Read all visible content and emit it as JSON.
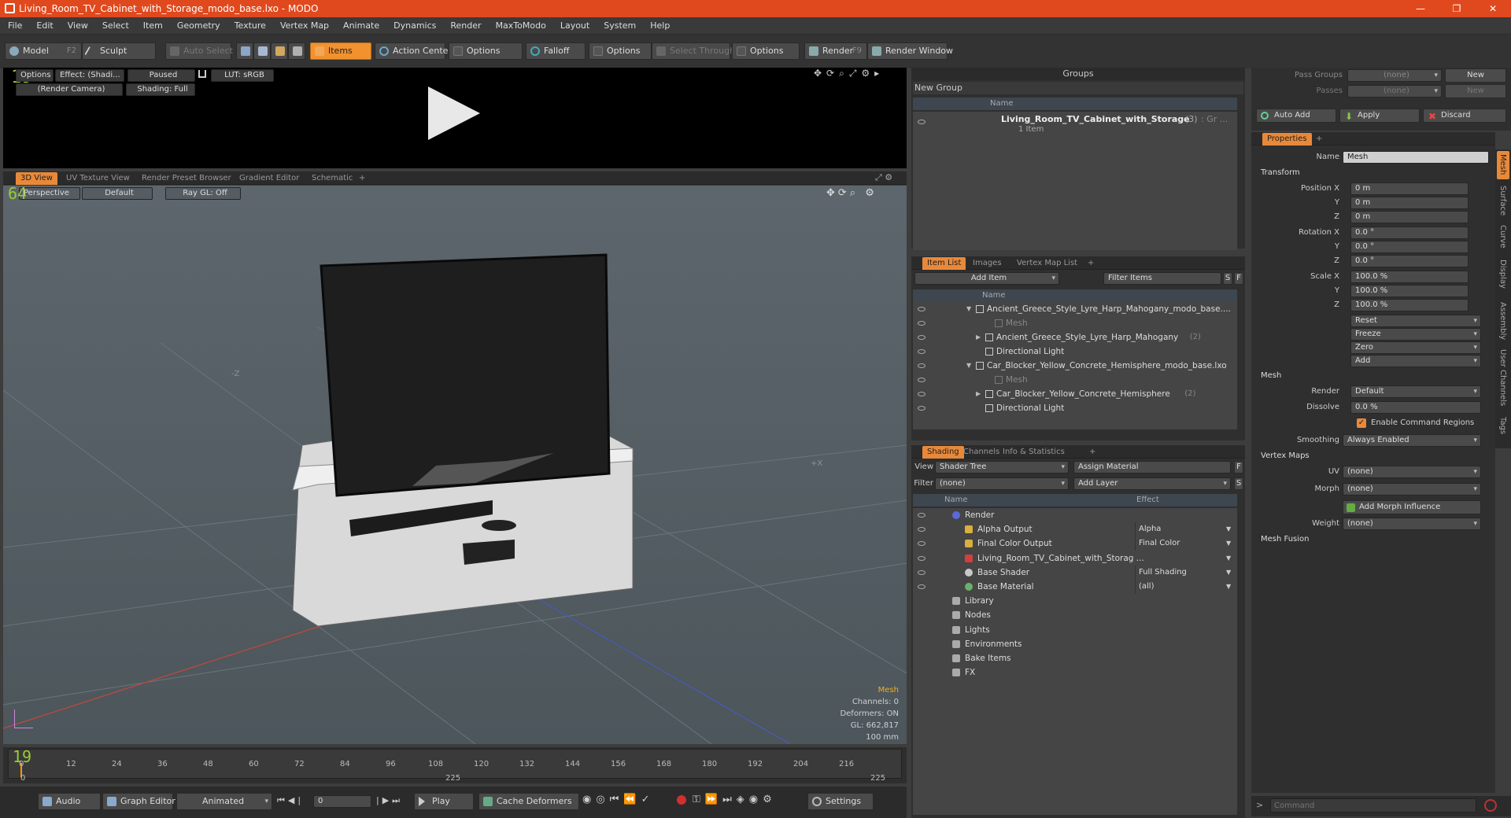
{
  "window": {
    "title": "Living_Room_TV_Cabinet_with_Storage_modo_base.lxo - MODO",
    "minimize": "—",
    "maximize": "❐",
    "close": "✕"
  },
  "menu": [
    "File",
    "Edit",
    "View",
    "Select",
    "Item",
    "Geometry",
    "Texture",
    "Vertex Map",
    "Animate",
    "Dynamics",
    "Render",
    "MaxToModo",
    "Layout",
    "System",
    "Help"
  ],
  "toolbar": {
    "model": "Model",
    "model_key": "F2",
    "sculpt": "Sculpt",
    "auto_select": "Auto Select",
    "items": "Items",
    "action_center": "Action Center",
    "options1": "Options",
    "falloff": "Falloff",
    "options2": "Options",
    "select_through": "Select Through",
    "options3": "Options",
    "render": "Render",
    "render_key": "F9",
    "render_window": "Render Window",
    "accent": "#f2922f"
  },
  "preview": {
    "options": "Options",
    "effect": "Effect: (Shadi...",
    "paused": "Paused",
    "lut": "LUT: sRGB",
    "camera": "(Render Camera)",
    "shading": "Shading: Full",
    "fps": "19"
  },
  "viewport_tabs": [
    "3D View",
    "UV Texture View",
    "Render Preset Browser",
    "Gradient Editor",
    "Schematic",
    "+"
  ],
  "viewport": {
    "perspective": "Perspective",
    "default": "Default",
    "raygl": "Ray GL: Off",
    "fps": "64",
    "info": {
      "selection": "Mesh",
      "channels": "Channels: 0",
      "deformers": "Deformers: ON",
      "gl": "GL: 662,817",
      "scale": "100 mm"
    },
    "axis_z": "-Z",
    "axis_x": "+X"
  },
  "timeline": {
    "ticks": [
      "0",
      "12",
      "24",
      "36",
      "48",
      "60",
      "72",
      "84",
      "96",
      "108",
      "120",
      "132",
      "144",
      "156",
      "168",
      "180",
      "192",
      "204",
      "216"
    ],
    "end": "225",
    "end2": "225",
    "start": "0",
    "frame_marker": "0"
  },
  "bottombar": {
    "audio": "Audio",
    "graph_editor": "Graph Editor",
    "animated": "Animated",
    "frame": "0",
    "play": "Play",
    "cache": "Cache Deformers",
    "settings": "Settings"
  },
  "groups": {
    "title": "Groups",
    "new_group": "New Group",
    "col_name": "Name",
    "item": "Living_Room_TV_Cabinet_with_Storage",
    "item_count": "(3)",
    "item_suffix": ": Gr ...",
    "item_sub": "1 Item"
  },
  "itemlist": {
    "tabs": [
      "Item List",
      "Images",
      "Vertex Map List",
      "+"
    ],
    "add_item": "Add Item",
    "filter": "Filter Items",
    "col_name": "Name",
    "s": "S",
    "f": "F",
    "rows": [
      {
        "label": "Ancient_Greece_Style_Lyre_Harp_Mahogany_modo_base....",
        "indent": 0,
        "arrow": "▼",
        "dim": false,
        "count": ""
      },
      {
        "label": "Mesh",
        "indent": 2,
        "arrow": "",
        "dim": true,
        "count": ""
      },
      {
        "label": "Ancient_Greece_Style_Lyre_Harp_Mahogany",
        "indent": 1,
        "arrow": "▶",
        "dim": false,
        "count": "(2)"
      },
      {
        "label": "Directional Light",
        "indent": 1,
        "arrow": "",
        "dim": false,
        "count": ""
      },
      {
        "label": "Car_Blocker_Yellow_Concrete_Hemisphere_modo_base.lxo",
        "indent": 0,
        "arrow": "▼",
        "dim": false,
        "count": ""
      },
      {
        "label": "Mesh",
        "indent": 2,
        "arrow": "",
        "dim": true,
        "count": ""
      },
      {
        "label": "Car_Blocker_Yellow_Concrete_Hemisphere",
        "indent": 1,
        "arrow": "▶",
        "dim": false,
        "count": "(2)"
      },
      {
        "label": "Directional Light",
        "indent": 1,
        "arrow": "",
        "dim": false,
        "count": ""
      }
    ]
  },
  "shading": {
    "tabs": [
      "Shading",
      "Channels",
      "Info & Statistics",
      "+"
    ],
    "view_label": "View",
    "view_value": "Shader Tree",
    "assign": "Assign Material",
    "filter_label": "Filter",
    "filter_value": "(none)",
    "add_layer": "Add Layer",
    "col_name": "Name",
    "col_effect": "Effect",
    "f": "F",
    "s": "S",
    "rows": [
      {
        "name": "Render",
        "effect": "",
        "indent": 0
      },
      {
        "name": "Alpha Output",
        "effect": "Alpha",
        "indent": 1
      },
      {
        "name": "Final Color Output",
        "effect": "Final Color",
        "indent": 1
      },
      {
        "name": "Living_Room_TV_Cabinet_with_Storag ...",
        "effect": "",
        "indent": 1
      },
      {
        "name": "Base Shader",
        "effect": "Full Shading",
        "indent": 1
      },
      {
        "name": "Base Material",
        "effect": "(all)",
        "indent": 1
      },
      {
        "name": "Library",
        "effect": "",
        "indent": 0
      },
      {
        "name": "Nodes",
        "effect": "",
        "indent": 0
      },
      {
        "name": "Lights",
        "effect": "",
        "indent": 0
      },
      {
        "name": "Environments",
        "effect": "",
        "indent": 0
      },
      {
        "name": "Bake Items",
        "effect": "",
        "indent": 0
      },
      {
        "name": "FX",
        "effect": "",
        "indent": 0
      }
    ]
  },
  "passes": {
    "pass_groups": "Pass Groups",
    "none1": "(none)",
    "new1": "New",
    "passes": "Passes",
    "none2": "(none)",
    "new2": "New",
    "auto_add": "Auto Add",
    "apply": "Apply",
    "discard": "Discard"
  },
  "properties": {
    "tab": "Properties",
    "plus": "+",
    "name_label": "Name",
    "name_value": "Mesh",
    "transform": "Transform",
    "position": {
      "label": "Position X",
      "y": "Y",
      "z": "Z",
      "vx": "0 m",
      "vy": "0 m",
      "vz": "0 m"
    },
    "rotation": {
      "label": "Rotation X",
      "y": "Y",
      "z": "Z",
      "vx": "0.0 °",
      "vy": "0.0 °",
      "vz": "0.0 °"
    },
    "scale": {
      "label": "Scale X",
      "y": "Y",
      "z": "Z",
      "vx": "100.0 %",
      "vy": "100.0 %",
      "vz": "100.0 %"
    },
    "reset": "Reset",
    "freeze": "Freeze",
    "zero": "Zero",
    "add": "Add",
    "mesh": "Mesh",
    "render_label": "Render",
    "render_value": "Default",
    "dissolve_label": "Dissolve",
    "dissolve_value": "0.0 %",
    "enable_cmd": "Enable Command Regions",
    "smoothing_label": "Smoothing",
    "smoothing_value": "Always Enabled",
    "vertex_maps": "Vertex Maps",
    "uv_label": "UV",
    "uv_value": "(none)",
    "morph_label": "Morph",
    "morph_value": "(none)",
    "add_morph": "Add Morph Influence",
    "weight_label": "Weight",
    "weight_value": "(none)",
    "mesh_fusion": "Mesh Fusion"
  },
  "side_tabs": [
    "Mesh",
    "Surface",
    "Curve",
    "Display",
    "Assembly",
    "User Channels",
    "Tags"
  ],
  "command": {
    "placeholder": "Command"
  }
}
